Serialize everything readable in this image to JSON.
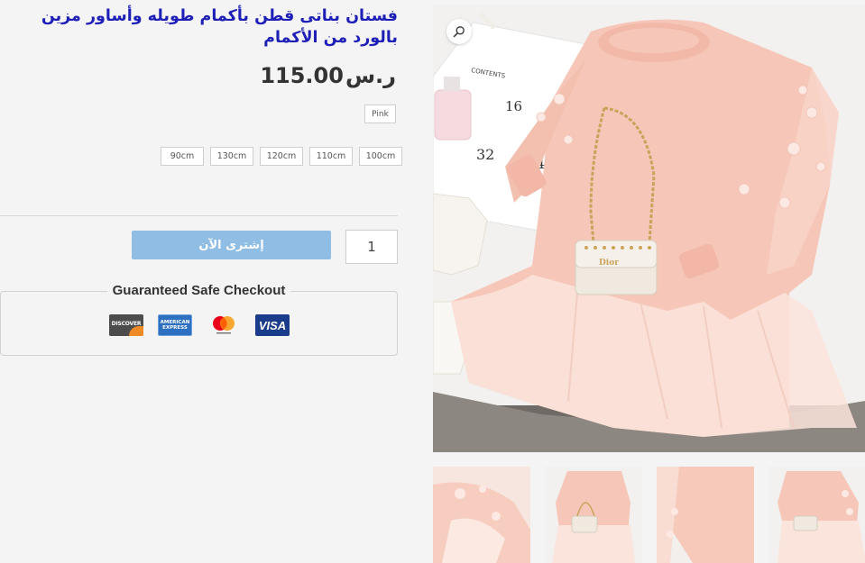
{
  "product": {
    "title": "فستان بناتى قطن بأكمام طويله وأساور مزين بالورد من الأكمام",
    "price_amount": "115.00",
    "price_currency": "ر.س"
  },
  "variations": {
    "color_selected": "Pink",
    "sizes": [
      "90cm",
      "130cm",
      "120cm",
      "110cm",
      "100cm"
    ]
  },
  "cart": {
    "buy_now_label": "إشترى الآن",
    "quantity": "1"
  },
  "checkout": {
    "title": "Guaranteed Safe Checkout",
    "payment_methods": [
      "discover-icon",
      "amex-icon",
      "mastercard-icon",
      "visa-icon"
    ],
    "discover_text": "DISCOVER",
    "amex_text_line1": "AMERICAN",
    "amex_text_line2": "EXPRESS",
    "visa_text": "VISA"
  },
  "gallery": {
    "zoom_icon": "search-icon",
    "thumbnail_count": 4
  },
  "colors": {
    "title": "#1e1fb7",
    "button": "#8fbde3",
    "dress": "#f6c7b8"
  }
}
